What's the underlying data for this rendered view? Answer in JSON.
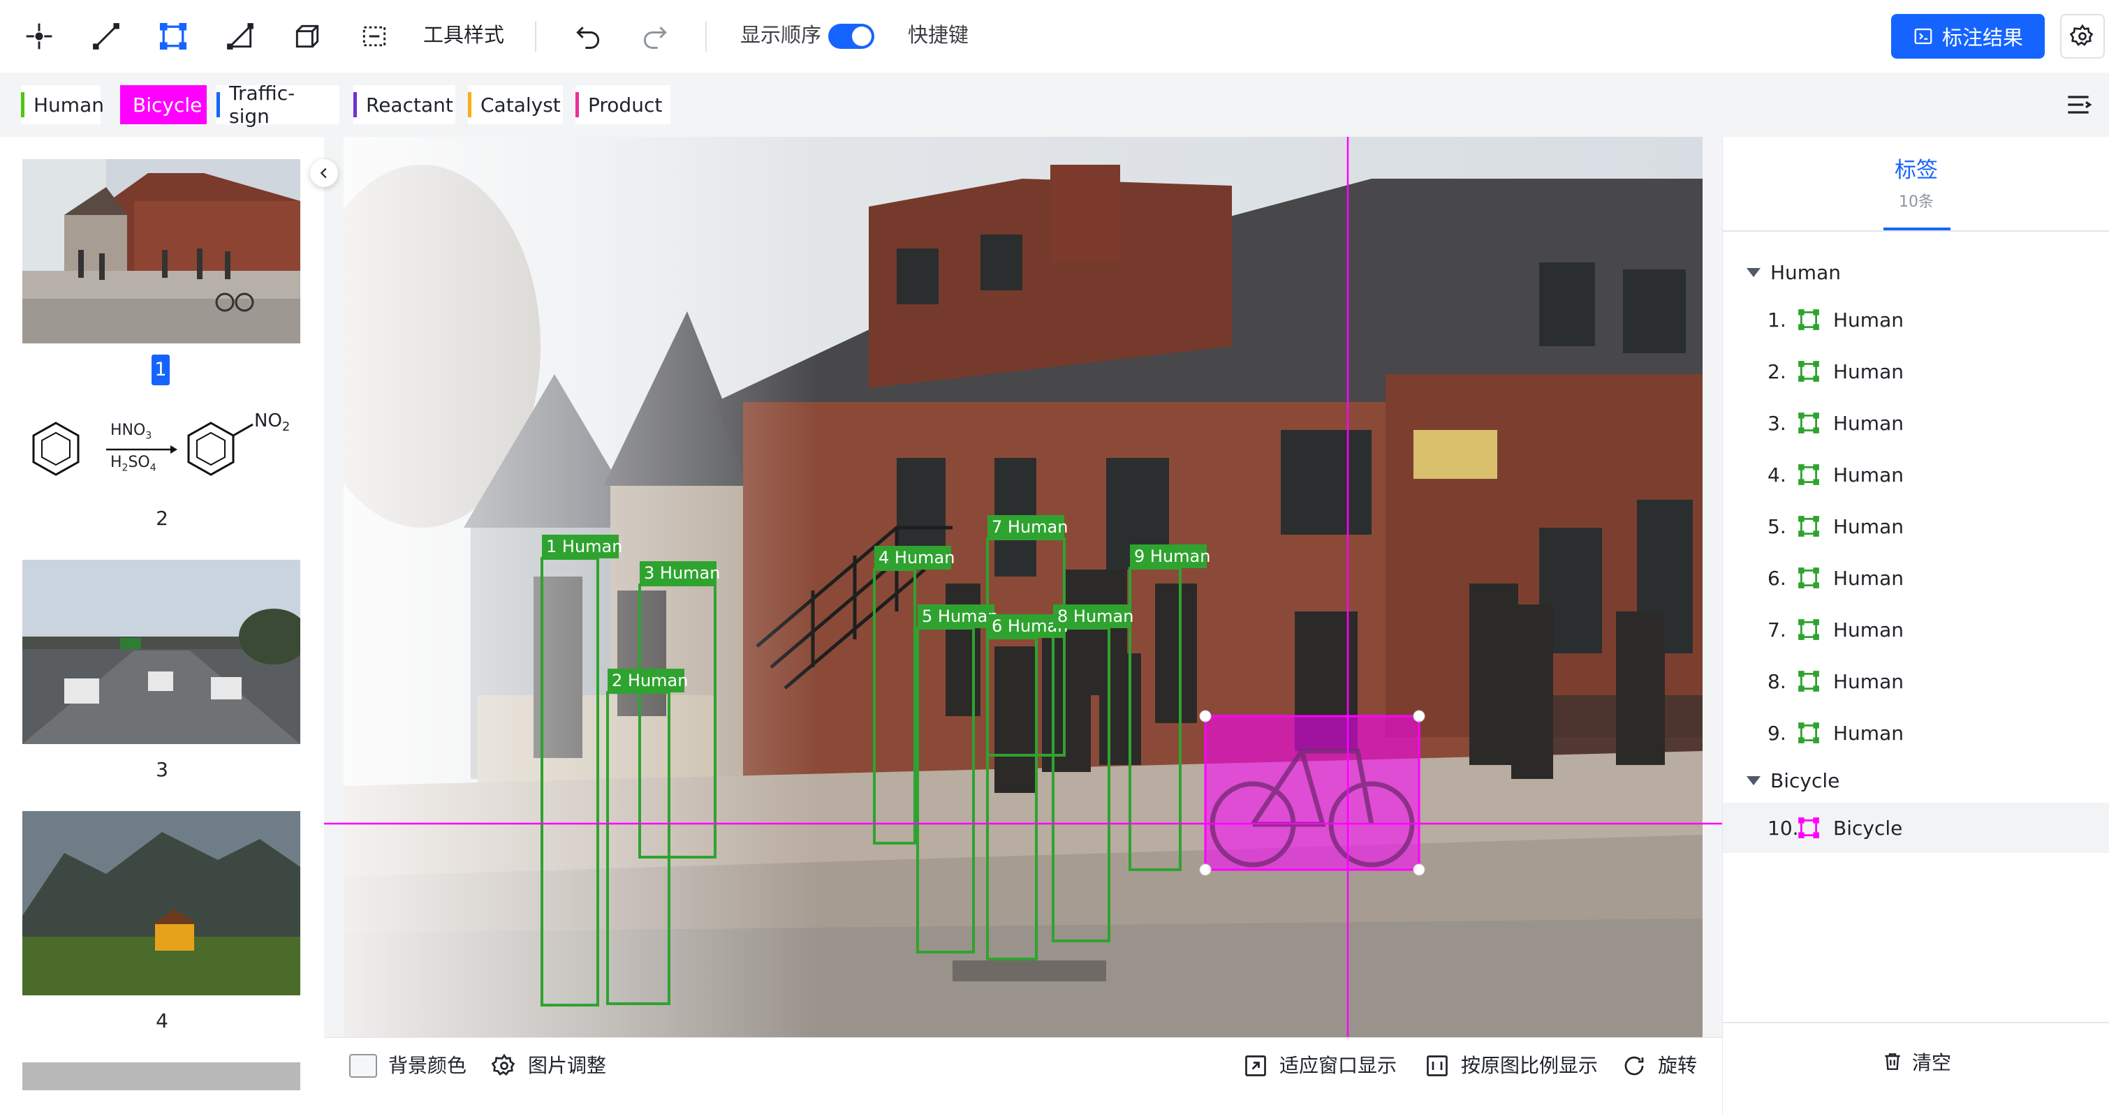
{
  "toolbar": {
    "tools": [
      "point-tool-icon",
      "line-tool-icon",
      "rect-tool-icon",
      "polygon-tool-icon",
      "cuboid-tool-icon",
      "segment-tool-icon"
    ],
    "tool_style_label": "工具样式",
    "show_order_label": "显示顺序",
    "show_order_on": true,
    "hotkey_label": "快捷键",
    "result_button_label": "标注结果"
  },
  "labels": [
    {
      "name": "Human",
      "color": "#52c41a",
      "active": false
    },
    {
      "name": "Bicycle",
      "color": "#ff00ff",
      "active": true
    },
    {
      "name": "Traffic-sign",
      "color": "#1664ff",
      "active": false
    },
    {
      "name": "Reactant",
      "color": "#722ed1",
      "active": false
    },
    {
      "name": "Catalyst",
      "color": "#faad14",
      "active": false
    },
    {
      "name": "Product",
      "color": "#eb2f96",
      "active": false
    }
  ],
  "thumbnails": [
    {
      "number": "1",
      "selected": true
    },
    {
      "number": "2",
      "selected": false,
      "formula": {
        "top": "HNO",
        "top_sub": "3",
        "bottom": "H",
        "bottom_sub": "2",
        "bottom_mid": "SO",
        "bottom_sub2": "4",
        "product": "NO",
        "product_sub": "2"
      }
    },
    {
      "number": "3",
      "selected": false
    },
    {
      "number": "4",
      "selected": false
    }
  ],
  "annotations": [
    {
      "id": 1,
      "label": "Human"
    },
    {
      "id": 2,
      "label": "Human"
    },
    {
      "id": 3,
      "label": "Human"
    },
    {
      "id": 4,
      "label": "Human"
    },
    {
      "id": 5,
      "label": "Human"
    },
    {
      "id": 6,
      "label": "Human"
    },
    {
      "id": 7,
      "label": "Human"
    },
    {
      "id": 8,
      "label": "Human"
    },
    {
      "id": 9,
      "label": "Human"
    },
    {
      "id": 10,
      "label": "Bicycle"
    }
  ],
  "bottom": {
    "bg_color_label": "背景颜色",
    "image_adjust_label": "图片调整",
    "fit_window_label": "适应窗口显示",
    "original_ratio_label": "按原图比例显示",
    "rotate_label": "旋转"
  },
  "right_panel": {
    "tab_title": "标签",
    "tab_count": "10条",
    "groups": [
      {
        "name": "Human",
        "items": [
          {
            "index": "1.",
            "name": "Human"
          },
          {
            "index": "2.",
            "name": "Human"
          },
          {
            "index": "3.",
            "name": "Human"
          },
          {
            "index": "4.",
            "name": "Human"
          },
          {
            "index": "5.",
            "name": "Human"
          },
          {
            "index": "6.",
            "name": "Human"
          },
          {
            "index": "7.",
            "name": "Human"
          },
          {
            "index": "8.",
            "name": "Human"
          },
          {
            "index": "9.",
            "name": "Human"
          }
        ]
      },
      {
        "name": "Bicycle",
        "items": [
          {
            "index": "10.",
            "name": "Bicycle",
            "selected": true
          }
        ]
      }
    ],
    "clear_label": "清空"
  },
  "colors": {
    "accent": "#1664ff",
    "human": "#2fa32f",
    "bicycle": "#ff00ff"
  }
}
